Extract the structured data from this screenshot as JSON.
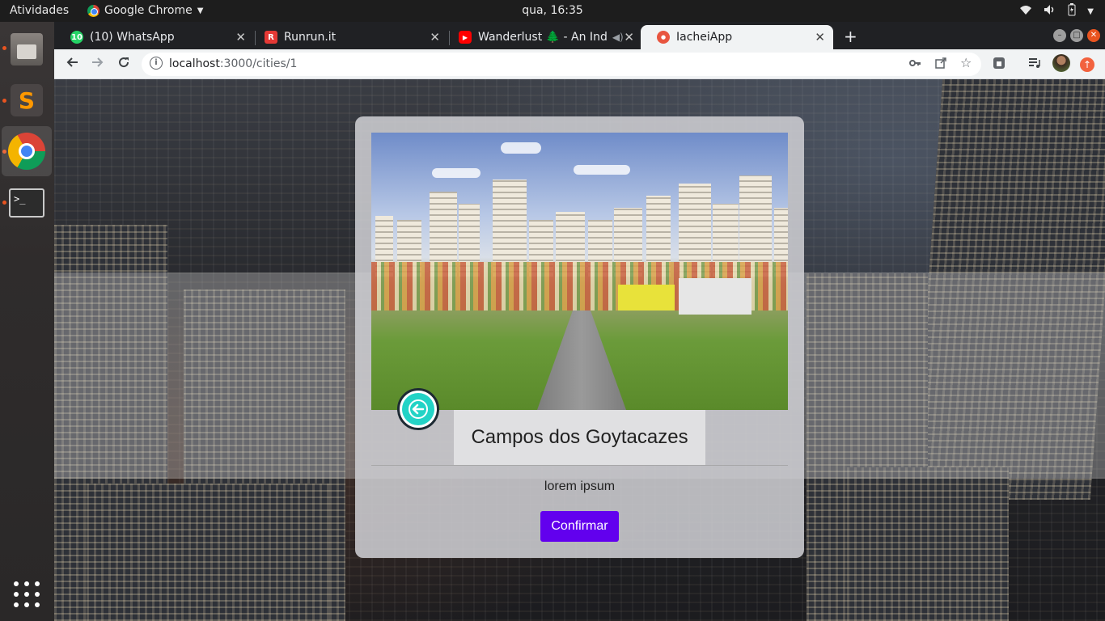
{
  "system": {
    "activities": "Atividades",
    "app_name": "Google Chrome",
    "clock": "qua, 16:35"
  },
  "tabs": [
    {
      "badge": "10",
      "title": "(10) WhatsApp",
      "favicon": "whatsapp-icon",
      "color": "#25d366"
    },
    {
      "badge": "R",
      "title": "Runrun.it",
      "favicon": "runrun-icon",
      "color": "#e53935"
    },
    {
      "badge": "▶",
      "title": "Wanderlust 🌲 - An Ind",
      "favicon": "youtube-icon",
      "color": "#ff0000"
    },
    {
      "badge": "●",
      "title": "IacheiApp",
      "favicon": "iachei-icon",
      "color": "#e8553f",
      "active": true
    }
  ],
  "address_bar": {
    "host": "localhost",
    "path": ":3000/cities/1"
  },
  "page": {
    "city_name": "Campos dos Goytacazes",
    "description": "lorem ipsum",
    "confirm_label": "Confirmar"
  },
  "colors": {
    "accent": "#6200ee",
    "back_button": "#22d3c6"
  }
}
